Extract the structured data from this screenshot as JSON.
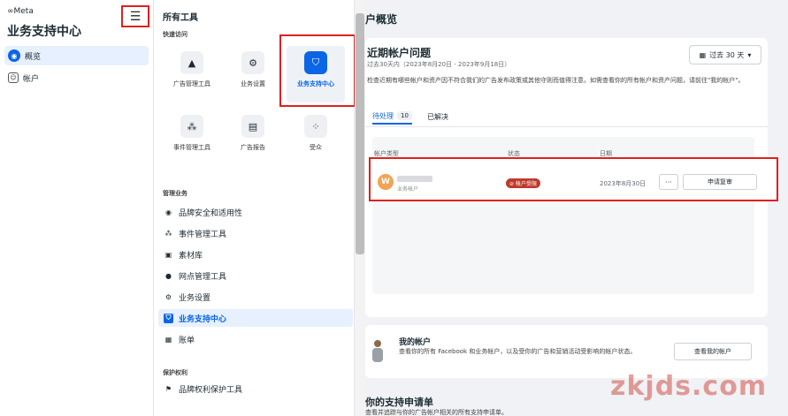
{
  "brand": {
    "logo": "∞Meta",
    "app_title": "业务支持中心"
  },
  "leftnav": {
    "menu_icon": "hamburger-icon",
    "items": [
      {
        "label": "概览",
        "icon": "globe-icon",
        "active": true
      },
      {
        "label": "帐户",
        "icon": "account-icon",
        "active": false
      }
    ]
  },
  "tools": {
    "title": "所有工具",
    "quick_access_label": "快速访问",
    "tiles": [
      {
        "label": "广告管理工具",
        "icon": "ads-manager-icon",
        "selected": false
      },
      {
        "label": "业务设置",
        "icon": "gear-icon",
        "selected": false
      },
      {
        "label": "业务支持中心",
        "icon": "support-center-icon",
        "selected": true
      },
      {
        "label": "事件管理工具",
        "icon": "events-manager-icon",
        "selected": false
      },
      {
        "label": "广告报告",
        "icon": "ads-report-icon",
        "selected": false
      },
      {
        "label": "受众",
        "icon": "audience-icon",
        "selected": false
      }
    ],
    "manage_label": "管理业务",
    "list": [
      {
        "label": "品牌安全和适用性",
        "icon": "shield-icon",
        "active": false
      },
      {
        "label": "事件管理工具",
        "icon": "events-manager-icon",
        "active": false
      },
      {
        "label": "素材库",
        "icon": "media-library-icon",
        "active": false
      },
      {
        "label": "网点管理工具",
        "icon": "location-icon",
        "active": false
      },
      {
        "label": "业务设置",
        "icon": "gear-icon",
        "active": false
      },
      {
        "label": "业务支持中心",
        "icon": "support-center-icon",
        "active": true
      },
      {
        "label": "账单",
        "icon": "billing-icon",
        "active": false
      }
    ],
    "protect_label": "保护权利",
    "protect_list": [
      {
        "label": "品牌权利保护工具",
        "icon": "flag-icon",
        "active": false
      }
    ]
  },
  "main": {
    "page_title": "户概览",
    "issues": {
      "title": "近期帐户问题",
      "subtitle": "过去30天内（2023年8月20日 - 2023年9月18日）",
      "date_range": "过去 30 天",
      "description": "检查近期有哪些帐户和资产因不符合我们的广告发布政策或其他守则而值得注意。如需查看你的所有帐户和资产问题，请前往\"我的帐户\"。",
      "tabs": [
        {
          "label": "待处理",
          "count": "10",
          "active": true
        },
        {
          "label": "已解决",
          "count": "",
          "active": false
        }
      ],
      "columns": [
        "帐户类型",
        "状态",
        "日期"
      ],
      "row": {
        "avatar": "W",
        "account_type": "业务帐户",
        "status": "帐户受限",
        "date": "2023年8月30日",
        "more": "···",
        "action": "申请复审"
      }
    },
    "my_account": {
      "title": "我的帐户",
      "description": "查看你的所有 Facebook 和业务帐户，以及受你的广告和营销活动受影响的帐户状态。",
      "button": "查看我的帐户"
    },
    "support": {
      "title": "你的支持申请单",
      "description": "查看并追踪与你的广告帐户相关的所有支持申请单。"
    }
  },
  "watermark": "zkjds.com",
  "colors": {
    "accent": "#0a66e4",
    "highlight": "#e0201f",
    "badge": "#c0392b"
  }
}
